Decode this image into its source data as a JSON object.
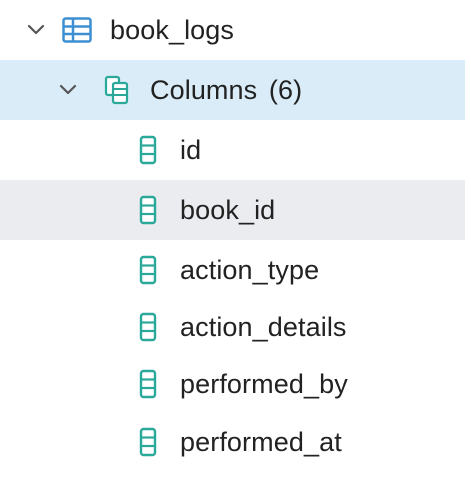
{
  "tree": {
    "table": {
      "name": "book_logs",
      "icon": "table-icon",
      "expanded": true
    },
    "columns_group": {
      "label": "Columns",
      "count": "(6)",
      "icon": "columns-group-icon",
      "expanded": true,
      "selected": true
    },
    "columns": [
      {
        "name": "id",
        "icon": "column-icon"
      },
      {
        "name": "book_id",
        "icon": "column-icon",
        "hovered": true
      },
      {
        "name": "action_type",
        "icon": "column-icon"
      },
      {
        "name": "action_details",
        "icon": "column-icon"
      },
      {
        "name": "performed_by",
        "icon": "column-icon"
      },
      {
        "name": "performed_at",
        "icon": "column-icon"
      }
    ]
  },
  "colors": {
    "icon_blue": "#3d8fd1",
    "icon_green": "#2aa89a",
    "selection_bg": "#d9ecf7",
    "hover_bg": "#ebecf0",
    "text": "#222222"
  }
}
